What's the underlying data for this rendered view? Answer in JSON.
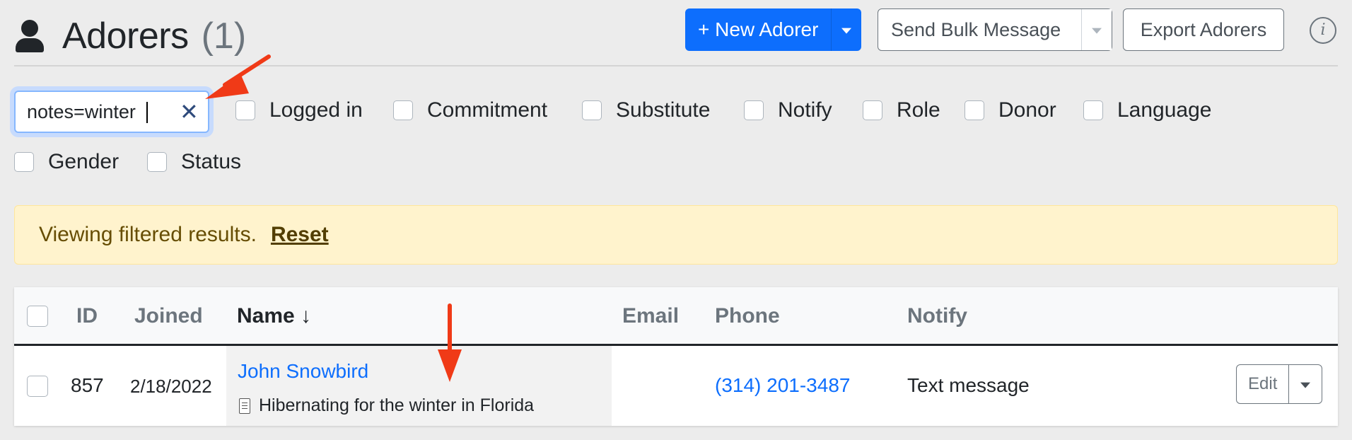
{
  "header": {
    "title": "Adorers",
    "count": "(1)",
    "new_button": "+ New Adorer",
    "bulk_button": "Send Bulk Message",
    "export_button": "Export Adorers",
    "info_icon": "info-icon"
  },
  "filters": {
    "search_value": "notes=winter",
    "items": [
      "Logged in",
      "Commitment",
      "Substitute",
      "Notify",
      "Role",
      "Donor",
      "Language",
      "Gender",
      "Status"
    ]
  },
  "alert": {
    "text": "Viewing filtered results.",
    "reset": "Reset"
  },
  "table": {
    "columns": {
      "id": "ID",
      "joined": "Joined",
      "name": "Name ↓",
      "email": "Email",
      "phone": "Phone",
      "notify": "Notify"
    },
    "rows": [
      {
        "id": "857",
        "joined": "2/18/2022",
        "name": "John Snowbird",
        "note": "Hibernating for the winter in Florida",
        "email": "",
        "phone": "(314) 201-3487",
        "notify": "Text message",
        "edit": "Edit"
      }
    ]
  },
  "colors": {
    "primary": "#0d6efd",
    "alert_bg": "#fff3cd",
    "annotation_arrow": "#f03a17"
  }
}
